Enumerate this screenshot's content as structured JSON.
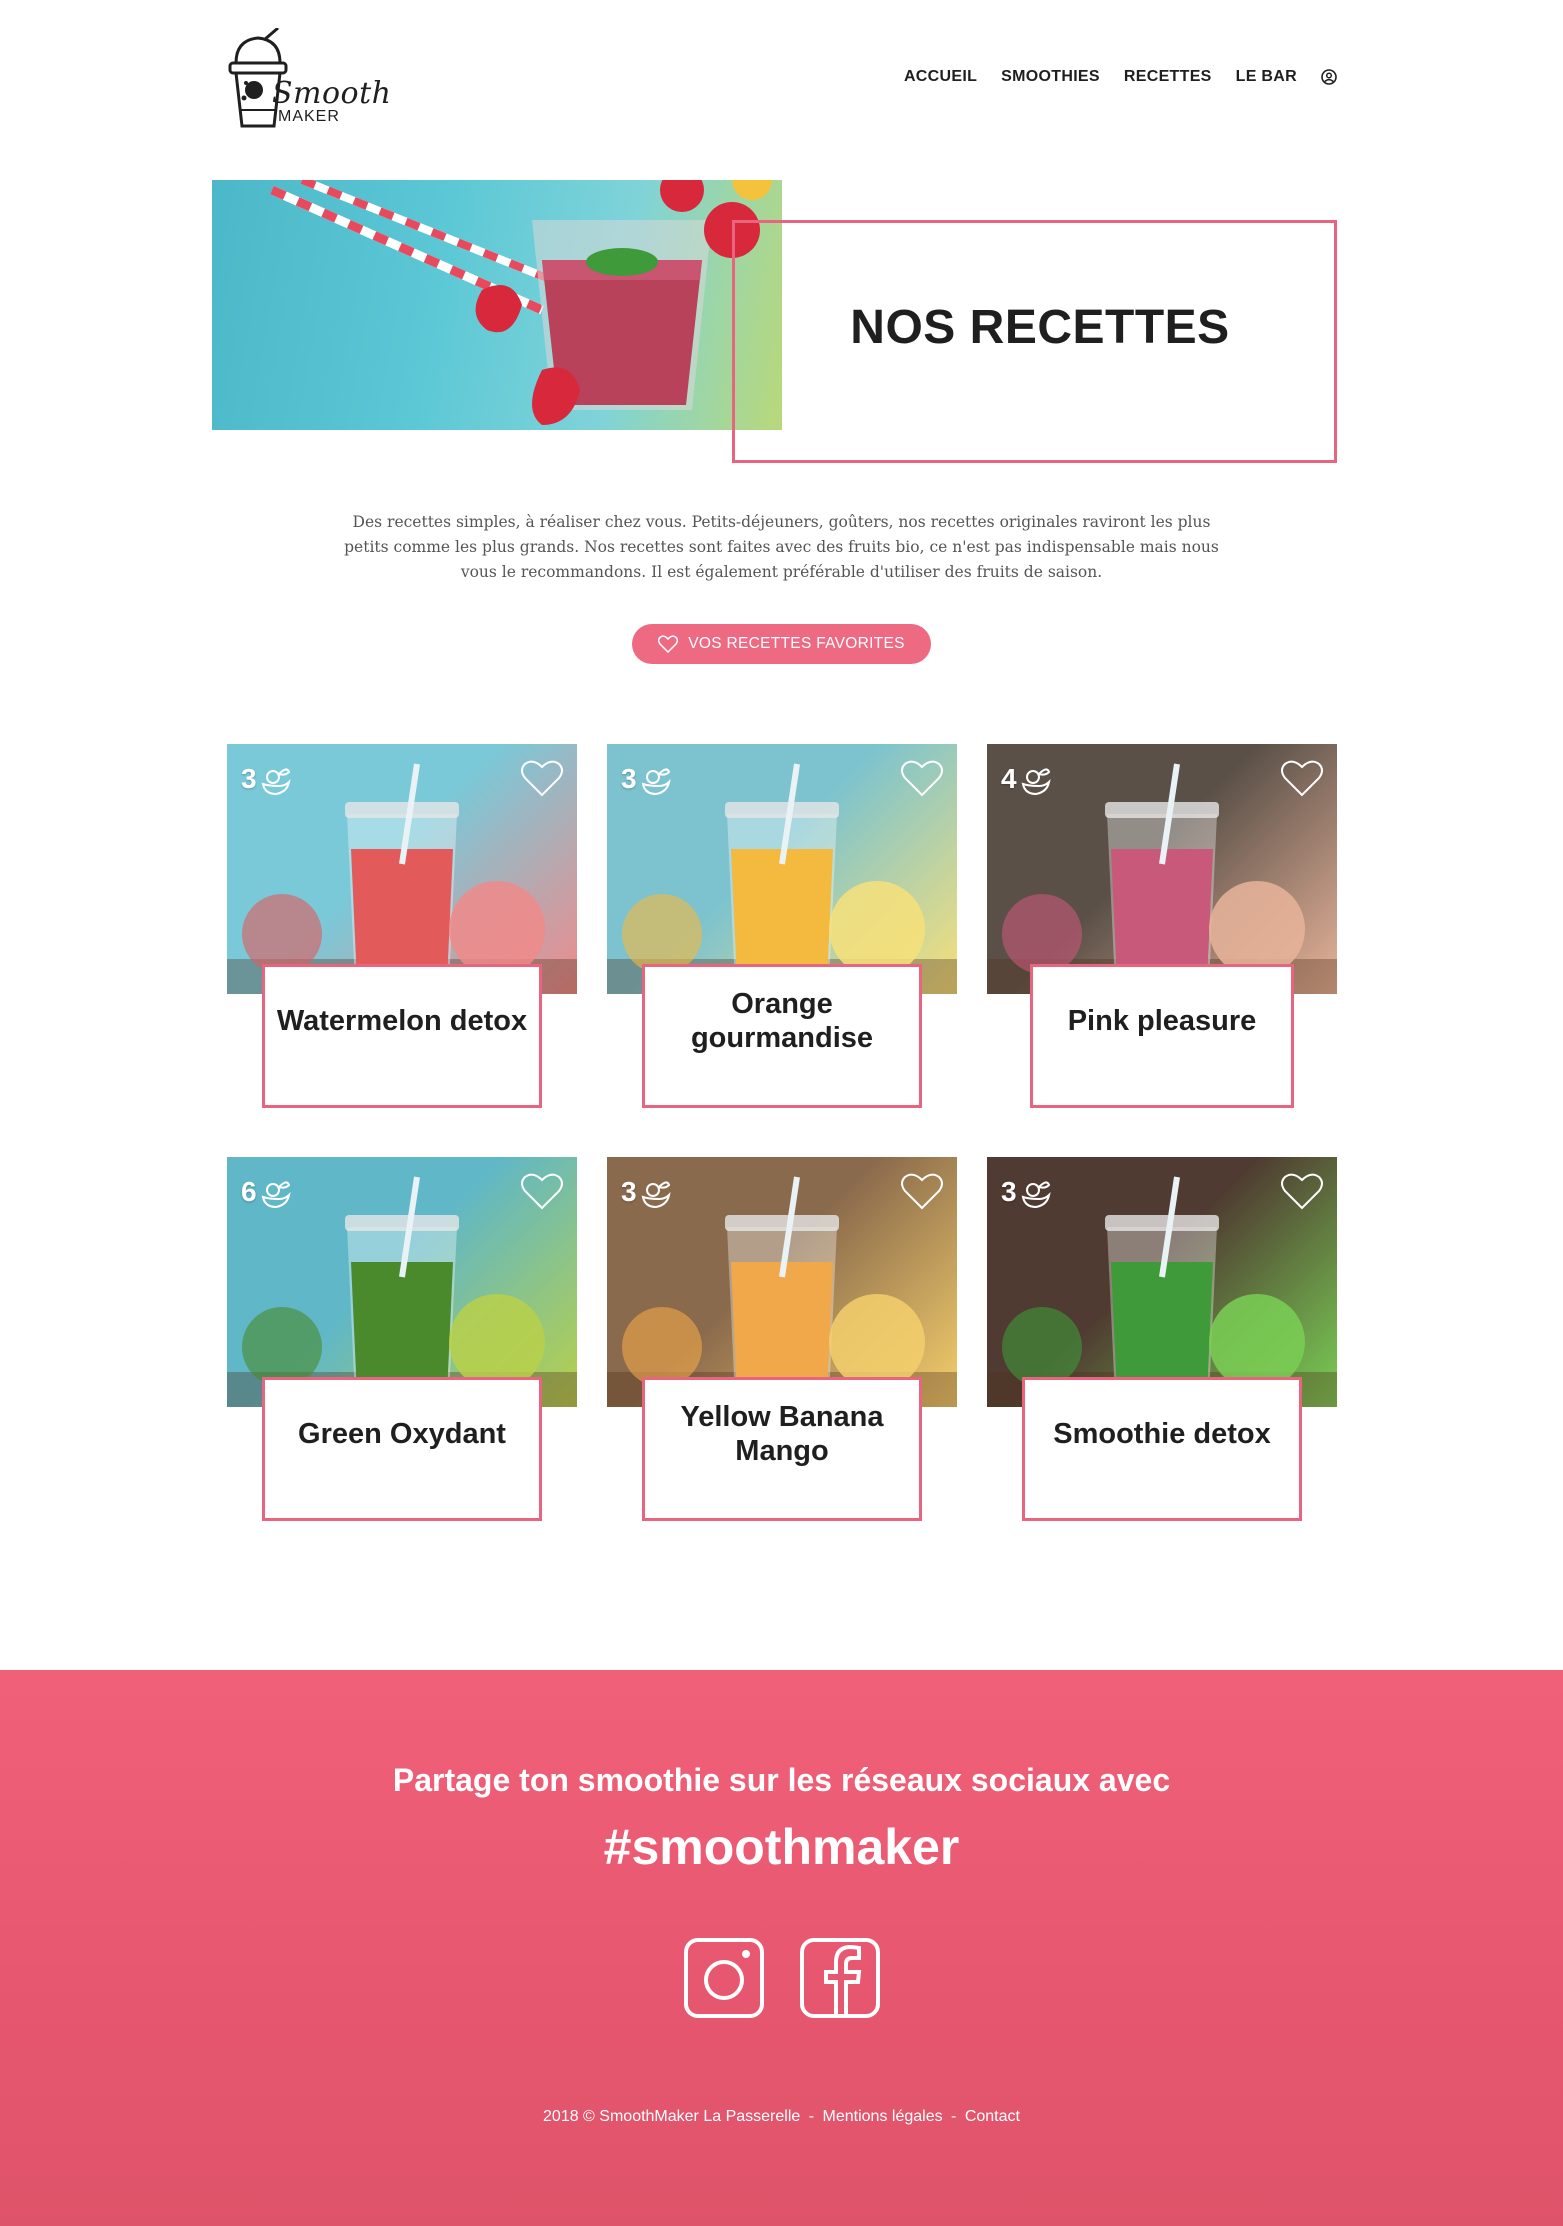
{
  "header": {
    "logo_text": "Smooth",
    "logo_sub": "MAKER",
    "nav": [
      "ACCUEIL",
      "SMOOTHIES",
      "RECETTES",
      "LE BAR"
    ]
  },
  "hero": {
    "title": "NOS RECETTES"
  },
  "intro": "Des recettes simples, à réaliser chez vous. Petits-déjeuners, goûters, nos recettes originales raviront les plus petits comme les plus grands. Nos recettes sont faites avec des fruits bio, ce n'est pas indispensable mais nous vous le recommandons. Il est également préférable d'utiliser des fruits de saison.",
  "fav_button": "VOS RECETTES FAVORITES",
  "recipes": [
    {
      "title": "Watermelon detox",
      "count": "3",
      "palette": [
        "#79c9d9",
        "#e35a5a",
        "#f08a8a"
      ]
    },
    {
      "title": "Orange gourmandise",
      "count": "3",
      "palette": [
        "#7cc3cf",
        "#f4b93f",
        "#f7e07a"
      ]
    },
    {
      "title": "Pink pleasure",
      "count": "4",
      "palette": [
        "#5a5048",
        "#c8597a",
        "#e8b49a"
      ]
    },
    {
      "title": "Green Oxydant",
      "count": "6",
      "palette": [
        "#5fb7c8",
        "#4a8a2c",
        "#b8d04a"
      ]
    },
    {
      "title": "Yellow Banana Mango",
      "count": "3",
      "palette": [
        "#8a6a4c",
        "#f0a84a",
        "#f4cf6c"
      ]
    },
    {
      "title": "Smoothie detox",
      "count": "3",
      "palette": [
        "#4f3b31",
        "#3f9a3a",
        "#7acf55"
      ]
    }
  ],
  "footer": {
    "line1": "Partage ton smoothie sur les réseaux sociaux avec",
    "hashtag": "#smoothmaker",
    "legal": [
      "2018 © SmoothMaker La Passerelle",
      "-",
      "Mentions légales",
      "-",
      "Contact"
    ]
  },
  "colors": {
    "accent": "#e9647e",
    "footer_bg": "#f16079",
    "text": "#1f1f1f"
  }
}
